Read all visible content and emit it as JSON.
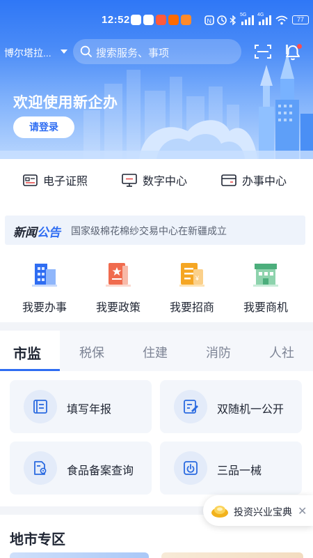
{
  "status_bar": {
    "time": "12:52",
    "battery": "77",
    "network_5g": "5G",
    "network_4g": "4G"
  },
  "header": {
    "city": "博尔塔拉...",
    "search_placeholder": "搜索服务、事项"
  },
  "hero": {
    "welcome": "欢迎使用新企办",
    "login_label": "请登录"
  },
  "quick_links": [
    {
      "label": "电子证照",
      "icon": "id-card-icon"
    },
    {
      "label": "数字中心",
      "icon": "monitor-icon"
    },
    {
      "label": "办事中心",
      "icon": "wallet-icon"
    }
  ],
  "news": {
    "tag_part1": "新闻",
    "tag_part2": "公告",
    "text": "国家级棉花棉纱交易中心在新疆成立"
  },
  "services": [
    {
      "label": "我要办事",
      "icon": "building-icon"
    },
    {
      "label": "我要政策",
      "icon": "policy-book-icon"
    },
    {
      "label": "我要招商",
      "icon": "investment-icon"
    },
    {
      "label": "我要商机",
      "icon": "market-icon"
    }
  ],
  "tabs": [
    "市监",
    "税保",
    "住建",
    "消防",
    "人社"
  ],
  "active_tab": "市监",
  "cards": [
    {
      "label": "填写年报",
      "icon": "report-list-icon"
    },
    {
      "label": "双随机一公开",
      "icon": "edit-form-icon"
    },
    {
      "label": "食品备案查询",
      "icon": "doc-search-icon"
    },
    {
      "label": "三品一械",
      "icon": "power-box-icon"
    }
  ],
  "region_title": "地市专区",
  "floating": {
    "label": "投资兴业宝典",
    "close": "✕"
  },
  "colors": {
    "primary": "#2f6df2",
    "hero_top": "#2f77f6",
    "card_bg": "#f3f6fb"
  }
}
